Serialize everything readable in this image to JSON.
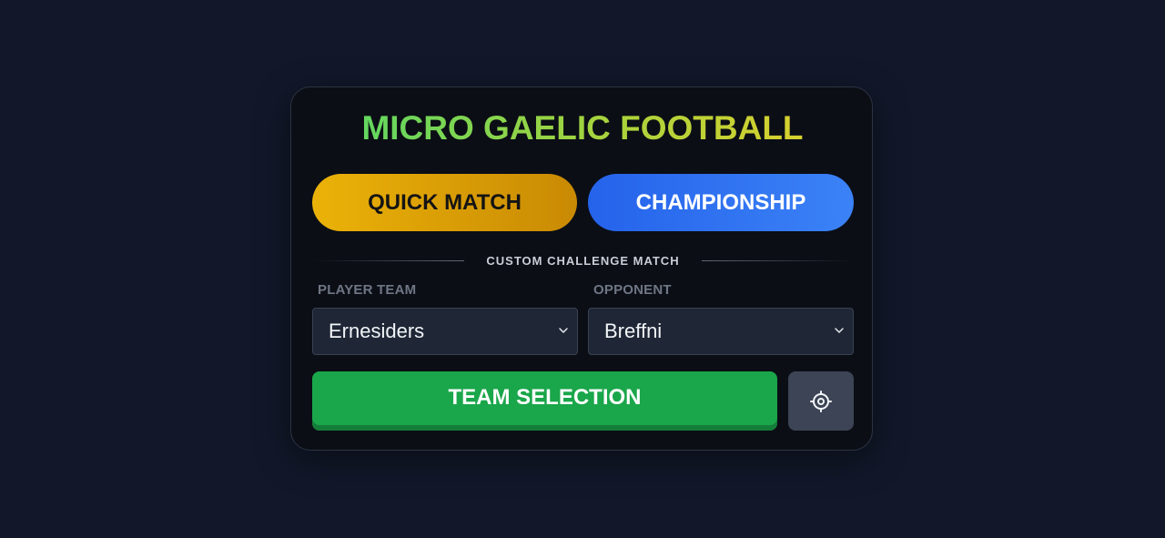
{
  "title": "MICRO GAELIC FOOTBALL",
  "modes": {
    "quick_match": "QUICK MATCH",
    "championship": "CHAMPIONSHIP"
  },
  "custom": {
    "heading": "CUSTOM CHALLENGE MATCH",
    "player_team_label": "PLAYER TEAM",
    "player_team_value": "Ernesiders",
    "opponent_label": "OPPONENT",
    "opponent_value": "Breffni"
  },
  "actions": {
    "team_selection": "TEAM SELECTION",
    "settings_icon": "gear-icon"
  },
  "colors": {
    "background": "#12182a",
    "card": "#0b0e15",
    "quick_match": "#ebb208",
    "championship": "#2563eb",
    "team_selection": "#1aa64a",
    "settings_button": "#3c4455"
  }
}
